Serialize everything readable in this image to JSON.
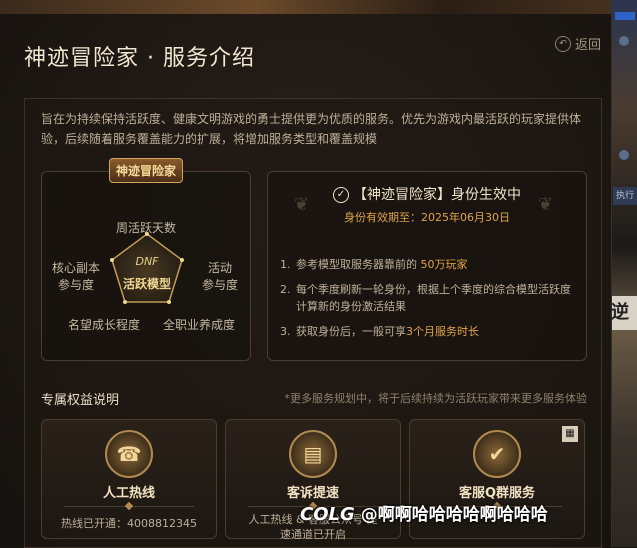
{
  "header": {
    "title": "神迹冒险家 · 服务介绍",
    "back_label": "返回"
  },
  "intro": "旨在为持续保持活跃度、健康文明游戏的勇士提供更为优质的服务。优先为游戏内最活跃的玩家提供体验，后续随着服务覆盖能力的扩展，将增加服务类型和覆盖规模",
  "radar": {
    "badge": "神迹冒险家",
    "center_label": "活跃模型",
    "center_logo": "DNF",
    "dims": {
      "top": "周活跃天数",
      "left": [
        "核心副本",
        "参与度"
      ],
      "right": [
        "活动",
        "参与度"
      ],
      "bottom_left": "名望成长程度",
      "bottom_right": "全职业养成度"
    }
  },
  "status": {
    "title": "【神迹冒险家】身份生效中",
    "valid": "身份有效期至：2025年06月30日",
    "items": [
      {
        "n": "1.",
        "text": "参考模型取服务器靠前的",
        "hl": "50万玩家"
      },
      {
        "n": "2.",
        "text": "每个季度刷新一轮身份，根据上个季度的综合模型活跃度计算新的身份激活结果",
        "hl": ""
      },
      {
        "n": "3.",
        "text": "获取身份后，一般可享",
        "hl": "3个月服务时长"
      }
    ]
  },
  "benefits": {
    "title": "专属权益说明",
    "note": "*更多服务规划中，将于后续持续为活跃玩家带来更多服务体验",
    "cards": [
      {
        "title": "人工热线",
        "sub": "热线已开通：4008812345",
        "icon": "headset-icon"
      },
      {
        "title": "客诉提速",
        "sub": "人工热线 & 客服公众号 提速通道已开启",
        "icon": "scroll-icon"
      },
      {
        "title": "客服Q群服务",
        "sub": "",
        "icon": "chat-check-icon"
      }
    ]
  },
  "watermark": {
    "logo": "COLG",
    "text": "@啊啊哈哈哈哈啊哈哈哈"
  },
  "colors": {
    "accent": "#e0a24a",
    "gold": "#b08a4e",
    "panel": "#1b1611"
  }
}
